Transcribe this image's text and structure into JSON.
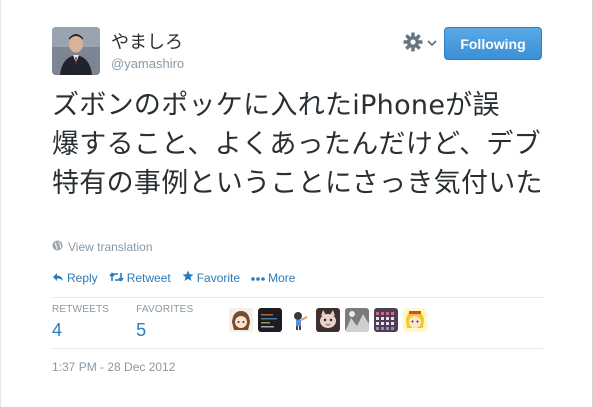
{
  "user": {
    "name": "やましろ",
    "handle": "@yamashiro"
  },
  "follow_button": {
    "label": "Following"
  },
  "tweet": {
    "lines": [
      "ズボンのポッケに入れたiPhoneが誤",
      "爆すること、よくあったんだけど、デブ",
      "特有の事例ということにさっき気付いた"
    ]
  },
  "translate": {
    "label": "View translation"
  },
  "actions": {
    "reply": "Reply",
    "retweet": "Retweet",
    "favorite": "Favorite",
    "more": "More"
  },
  "stats": {
    "retweets_label": "RETWEETS",
    "retweets_value": "4",
    "favorites_label": "FAVORITES",
    "favorites_value": "5"
  },
  "favoriters": [
    {
      "icon": "avatar-anime-girl-icon"
    },
    {
      "icon": "avatar-dark-screen-icon"
    },
    {
      "icon": "avatar-mini-figure-icon"
    },
    {
      "icon": "avatar-cat-icon"
    },
    {
      "icon": "avatar-gray-photo-icon"
    },
    {
      "icon": "avatar-pixel-grid-icon"
    },
    {
      "icon": "avatar-yellow-character-icon"
    }
  ],
  "timestamp": "1:37 PM - 28 Dec 2012",
  "colors": {
    "link": "#2b7bb9",
    "muted": "#8899a6",
    "button": "#4a9de0",
    "text": "#292f33"
  }
}
